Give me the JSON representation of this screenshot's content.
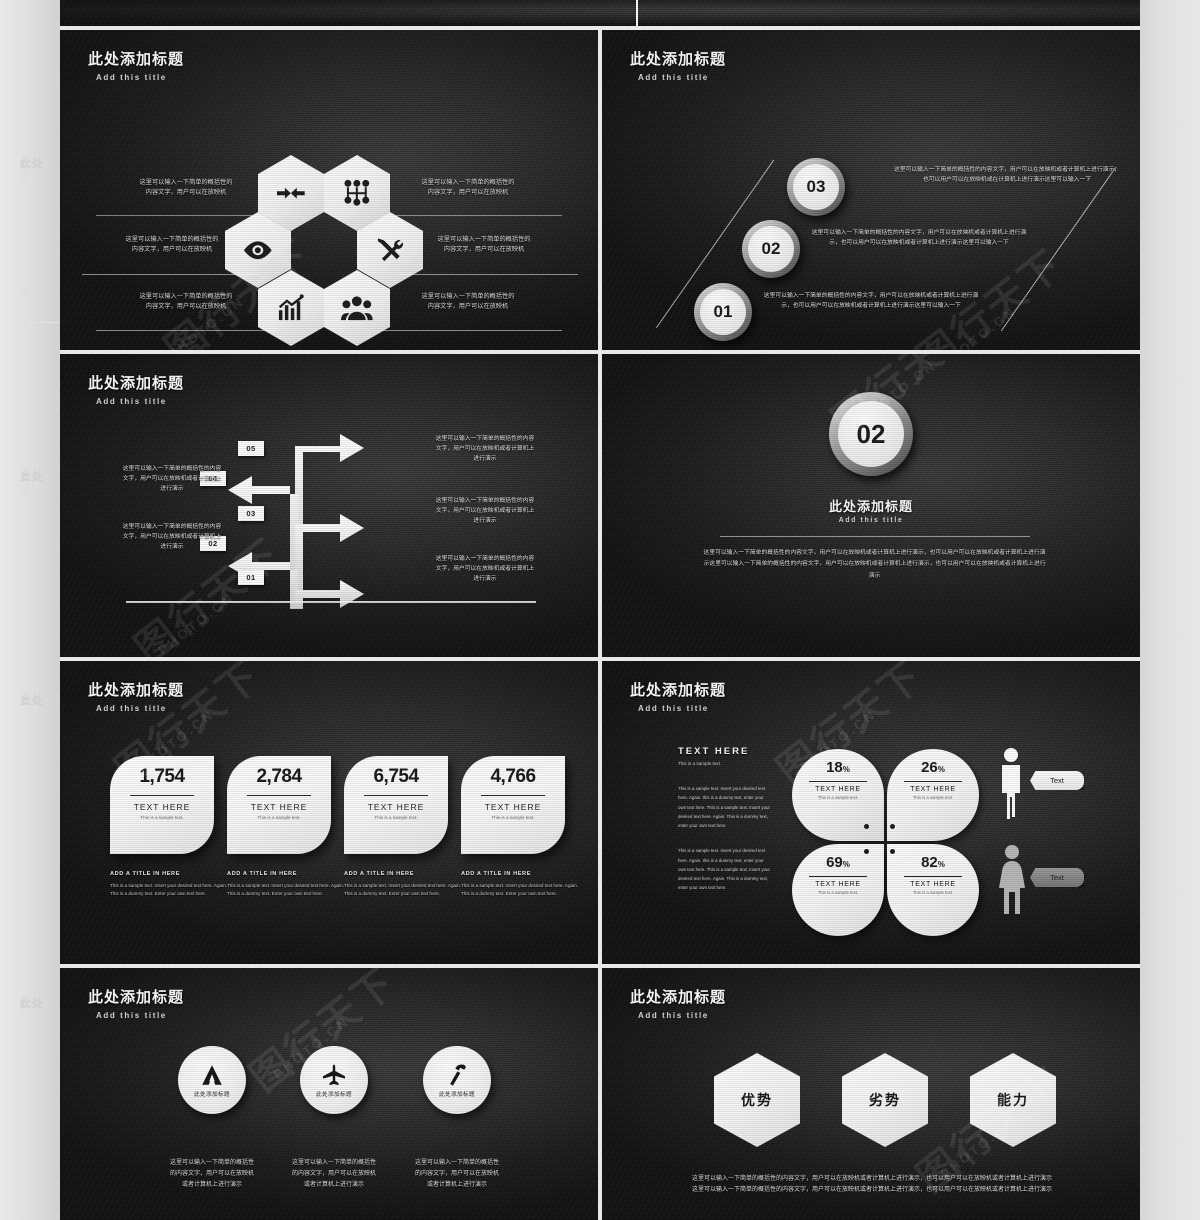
{
  "deck": {
    "common": {
      "title_cn": "此处添加标题",
      "title_en": "Add this title",
      "body_cn": "这里可以输入一下简单的概括性的内容文字，用户可以在放映机",
      "body_cn2": "或者计算机上进行演示",
      "text_here": "TEXT HERE",
      "sample": "This is a sample text.",
      "watermark_main": "图行天下",
      "watermark_sub": "PHOTO.CN"
    },
    "slide_hex": {
      "title_cn": "此处添加标题",
      "title_en": "Add this title",
      "items": [
        {
          "icon": "arrows-converge-icon",
          "text": "这里可以输入一下简单的概括性的\n内容文字，用户可以在放映机"
        },
        {
          "icon": "network-nodes-icon",
          "text": "这里可以输入一下简单的概括性的\n内容文字，用户可以在放映机"
        },
        {
          "icon": "eye-icon",
          "text": "这里可以输入一下简单的概括性的\n内容文字，用户可以在放映机"
        },
        {
          "icon": "hammer-wrench-icon",
          "text": "这里可以输入一下简单的概括性的\n内容文字，用户可以在放映机"
        },
        {
          "icon": "bar-chart-icon",
          "text": "这里可以输入一下简单的概括性的\n内容文字，用户可以在放映机"
        },
        {
          "icon": "people-group-icon",
          "text": "这里可以输入一下简单的概括性的\n内容文字，用户可以在放映机"
        }
      ],
      "left_texts": [
        "这里可以输入一下简单的概括性的\n内容文字，用户可以在放映机",
        "这里可以输入一下简单的概括性的\n内容文字，用户可以在放映机",
        "这里可以输入一下简单的概括性的\n内容文字，用户可以在放映机"
      ],
      "right_texts": [
        "这里可以输入一下简单的概括性的\n内容文字，用户可以在放映机",
        "这里可以输入一下简单的概括性的\n内容文字，用户可以在放映机",
        "这里可以输入一下简单的概括性的\n内容文字，用户可以在放映机"
      ]
    },
    "slide_steps": {
      "title_cn": "此处添加标题",
      "title_en": "Add this title",
      "items": [
        {
          "num": "03",
          "text": "这里可以输入一下简单的概括性的内容文字，用户可以在放映机或者计算机上进行演示，也可以用户可以在放映机或在计算机上进行演示这里可以输入一下"
        },
        {
          "num": "02",
          "text": "这里可以输入一下简单的概括性的内容文字，用户可以在放映机或者计算机上进行演示，也可以用户可以在放映机或者计算机上进行演示这里可以输入一下"
        },
        {
          "num": "01",
          "text": "这里可以输入一下简单的概括性的内容文字，用户可以在放映机或者计算机上进行演示，也可以用户可以在放映机或者计算机上进行演示这里可以输入一下"
        }
      ]
    },
    "slide_flow": {
      "title_cn": "此处添加标题",
      "title_en": "Add this title",
      "nums": [
        "05",
        "04",
        "03",
        "02",
        "01"
      ],
      "right_texts": [
        "这里可以输入一下简单的概括性的内容\n文字，用户可以在放映机或者计算机上\n进行演示",
        "这里可以输入一下简单的概括性的内容\n文字，用户可以在放映机或者计算机上\n进行演示",
        "这里可以输入一下简单的概括性的内容\n文字，用户可以在放映机或者计算机上\n进行演示"
      ],
      "left_texts": [
        "这里可以输入一下简单的概括性的内容\n文字，用户可以在放映机或者计算机上\n进行演示",
        "这里可以输入一下简单的概括性的内容\n文字，用户可以在放映机或者计算机上\n进行演示"
      ]
    },
    "slide_section": {
      "number": "02",
      "title_cn": "此处添加标题",
      "title_en": "Add this title",
      "body": "这里可以输入一下简单的概括性的内容文字，用户可以在放映机或者计算机上进行演示，也可以用户可以在放映机或者计算机上进行演示这里可以输入一下简单的概括性的内容文字，用户可以在放映机或者计算机上进行演示，也可以用户可以在放映机或者计算机上进行演示"
    },
    "slide_stats": {
      "title_cn": "此处添加标题",
      "title_en": "Add this title",
      "cards": [
        {
          "value": "1,754",
          "label": "TEXT HERE",
          "sub": "This is a sample text.",
          "cap_title": "ADD A TITLE IN HERE",
          "cap_body": "This is a sample text. Insert your desired text here. Again. This is a dummy text. Enter your own text here."
        },
        {
          "value": "2,784",
          "label": "TEXT HERE",
          "sub": "This is a sample text.",
          "cap_title": "ADD A TITLE IN HERE",
          "cap_body": "This is a sample text. Insert your desired text here. Again. This is a dummy text. Enter your own text here."
        },
        {
          "value": "6,754",
          "label": "TEXT HERE",
          "sub": "This is a sample text.",
          "cap_title": "ADD A TITLE IN HERE",
          "cap_body": "This is a sample text. Insert your desired text here. Again. This is a dummy text. Enter your own text here."
        },
        {
          "value": "4,766",
          "label": "TEXT HERE",
          "sub": "This is a sample text.",
          "cap_title": "ADD A TITLE IN HERE",
          "cap_body": "This is a sample text. Insert your desired text here. Again. This is a dummy text. Enter your own text here."
        }
      ]
    },
    "slide_percent": {
      "title_cn": "此处添加标题",
      "title_en": "Add this title",
      "side_heading": "TEXT HERE",
      "side_sub": "This is a sample text.",
      "side_p1": "This is a sample text. Insert your desired text here. Again. this is a dummy text, enter your own text here. This is a sample text. Insert your desired text here. Again. This is a dummy text, enter your own text here.",
      "side_p2": "This is a sample text. Insert your desired text here. Again. this is a dummy text, enter your own text here. This is a sample text. Insert your desired text here. Again. This is a dummy text, enter your own text here.",
      "petals": [
        {
          "value": "18",
          "unit": "%",
          "label": "TEXT HERE",
          "sub": "This is a sample text."
        },
        {
          "value": "26",
          "unit": "%",
          "label": "TEXT HERE",
          "sub": "This is a sample text."
        },
        {
          "value": "69",
          "unit": "%",
          "label": "TEXT HERE",
          "sub": "This is a sample text."
        },
        {
          "value": "82",
          "unit": "%",
          "label": "TEXT HERE",
          "sub": "This is a sample text."
        }
      ],
      "male_bubble": "Text",
      "female_bubble": "Text",
      "male_icon": "male-figure-icon",
      "female_icon": "female-figure-icon"
    },
    "slide_icons": {
      "title_cn": "此处添加标题",
      "title_en": "Add this title",
      "items": [
        {
          "icon": "tent-icon",
          "circle_label": "此处添加标题",
          "caption": "这里可以输入一下简单的概括性\n的内容文字，用户可以在放映机\n或者计算机上进行演示"
        },
        {
          "icon": "airplane-icon",
          "circle_label": "此处添加标题",
          "caption": "这里可以输入一下简单的概括性\n的内容文字，用户可以在放映机\n或者计算机上进行演示"
        },
        {
          "icon": "hammer-icon",
          "circle_label": "此处添加标题",
          "caption": "这里可以输入一下简单的概括性\n的内容文字，用户可以在放映机\n或者计算机上进行演示"
        }
      ]
    },
    "slide_swot": {
      "title_cn": "此处添加标题",
      "title_en": "Add this title",
      "hexes": [
        "优势",
        "劣势",
        "能力"
      ],
      "footer": "这里可以输入一下简单的概括性的内容文字，用户可以在放映机或者计算机上进行演示，也可以用户可以在放映机或者计算机上进行演示这里可以输入一下简单的概括性的内容文字，用户可以在放映机或者计算机上进行演示，也可以用户可以在放映机或者计算机上进行演示"
    }
  },
  "gutter": {
    "ghost1": "此处",
    "ghost1_sub": "Ad",
    "ghost2": "此处",
    "ghost2_sub": "Ad",
    "ghost3": "此处",
    "ghost4": "此处"
  }
}
